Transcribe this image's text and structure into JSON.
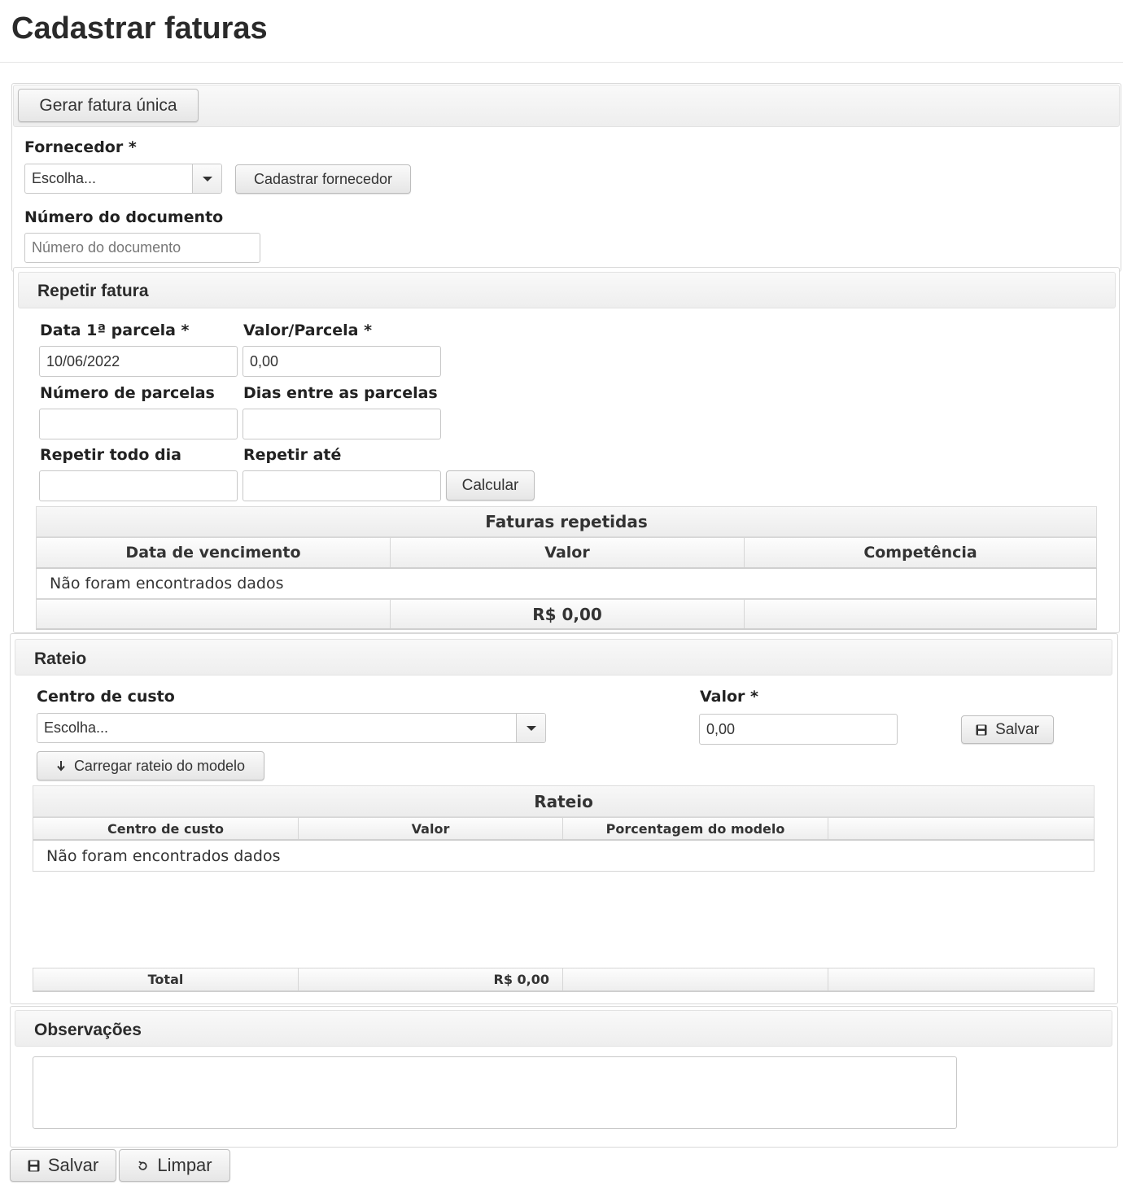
{
  "page": {
    "title": "Cadastrar faturas"
  },
  "toolbar": {
    "gerar_label": "Gerar fatura única"
  },
  "form": {
    "fornecedor_label": "Fornecedor *",
    "fornecedor_value": "Escolha...",
    "cadastrar_fornecedor_label": "Cadastrar fornecedor",
    "numero_documento_label": "Número do documento",
    "numero_documento_placeholder": "Número do documento"
  },
  "repetir": {
    "title": "Repetir fatura",
    "data_label": "Data 1ª parcela *",
    "data_value": "10/06/2022",
    "valor_label": "Valor/Parcela *",
    "valor_value": "0,00",
    "num_parcelas_label": "Número de parcelas",
    "num_parcelas_value": "",
    "dias_label": "Dias entre as parcelas",
    "dias_value": "",
    "repetir_dia_label": "Repetir todo dia",
    "repetir_dia_value": "",
    "repetir_ate_label": "Repetir até",
    "repetir_ate_value": "",
    "calcular_label": "Calcular",
    "table": {
      "caption": "Faturas repetidas",
      "columns": [
        "Data de vencimento",
        "Valor",
        "Competência"
      ],
      "empty_text": "Não foram encontrados dados",
      "total": "R$ 0,00"
    }
  },
  "rateio": {
    "title": "Rateio",
    "centro_label": "Centro de custo",
    "centro_value": "Escolha...",
    "valor_label": "Valor *",
    "valor_value": "0,00",
    "salvar_label": "Salvar",
    "carregar_label": "Carregar rateio do modelo",
    "table": {
      "caption": "Rateio",
      "columns": [
        "Centro de custo",
        "Valor",
        "Porcentagem do modelo",
        ""
      ],
      "empty_text": "Não foram encontrados dados",
      "total_label": "Total",
      "total_value": "R$ 0,00"
    }
  },
  "observacoes": {
    "title": "Observações",
    "value": ""
  },
  "footer": {
    "salvar_label": "Salvar",
    "limpar_label": "Limpar"
  }
}
